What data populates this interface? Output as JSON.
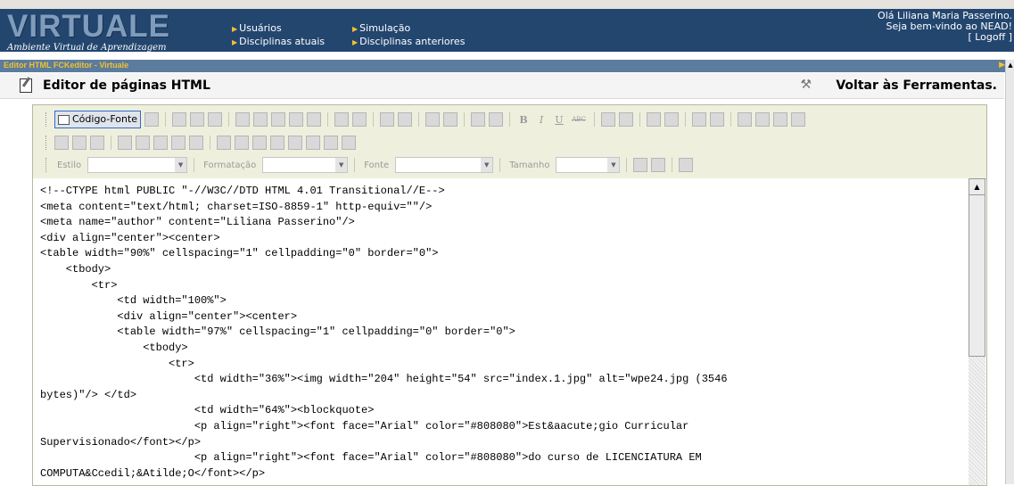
{
  "header": {
    "logo": "VIRTUALE",
    "logo_subtitle": "Ambiente Virtual de Aprendizagem",
    "nav": [
      {
        "label": "Usuários"
      },
      {
        "label": "Simulação"
      },
      {
        "label": "Disciplinas atuais"
      },
      {
        "label": "Disciplinas anteriores"
      }
    ],
    "greeting_line1": "Olá Liliana Maria Passerino.",
    "greeting_line2": "Seja bem-vindo ao NEAD!",
    "logoff": "[ Logoff ]"
  },
  "window": {
    "title": "Editor HTML FCKeditor - Virtuale"
  },
  "page": {
    "title": "Editor de páginas HTML",
    "back_link": "Voltar às Ferramentas."
  },
  "toolbar": {
    "source_button": "Código-Fonte",
    "style_label": "Estilo",
    "format_label": "Formatação",
    "font_label": "Fonte",
    "size_label": "Tamanho",
    "format_buttons": [
      "B",
      "I",
      "U",
      "ABC"
    ]
  },
  "source_code": "<!--CTYPE html PUBLIC \"-//W3C//DTD HTML 4.01 Transitional//E-->\n<meta content=\"text/html; charset=ISO-8859-1\" http-equiv=\"\"/>\n<meta name=\"author\" content=\"Liliana Passerino\"/>\n<div align=\"center\"><center>\n<table width=\"90%\" cellspacing=\"1\" cellpadding=\"0\" border=\"0\">\n    <tbody>\n        <tr>\n            <td width=\"100%\">\n            <div align=\"center\"><center>\n            <table width=\"97%\" cellspacing=\"1\" cellpadding=\"0\" border=\"0\">\n                <tbody>\n                    <tr>\n                        <td width=\"36%\"><img width=\"204\" height=\"54\" src=\"index.1.jpg\" alt=\"wpe24.jpg (3546\nbytes)\"/> </td>\n                        <td width=\"64%\"><blockquote>\n                        <p align=\"right\"><font face=\"Arial\" color=\"#808080\">Est&aacute;gio Curricular\nSupervisionado</font></p>\n                        <p align=\"right\"><font face=\"Arial\" color=\"#808080\">do curso de LICENCIATURA EM\nCOMPUTA&Ccedil;&Atilde;O</font></p>"
}
